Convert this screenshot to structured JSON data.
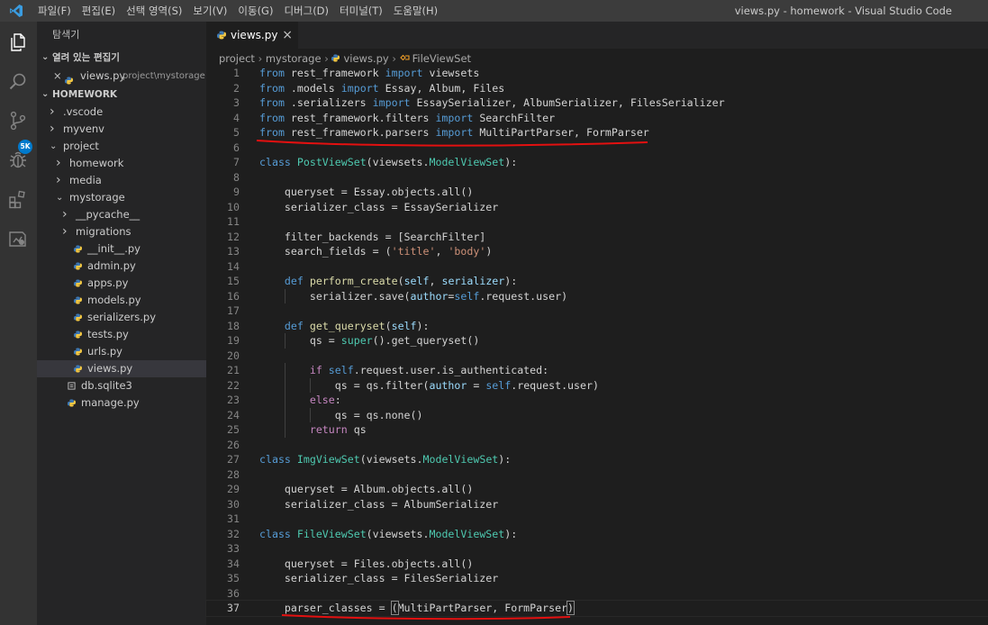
{
  "titlebar": {
    "menu": [
      "파일(F)",
      "편집(E)",
      "선택 영역(S)",
      "보기(V)",
      "이동(G)",
      "디버그(D)",
      "터미널(T)",
      "도움말(H)"
    ],
    "title": "views.py - homework - Visual Studio Code"
  },
  "activity_bar": {
    "icons": [
      "explorer-icon",
      "search-icon",
      "source-control-icon",
      "debug-icon",
      "extensions-icon",
      "remote-icon"
    ],
    "badge": "5K"
  },
  "sidebar": {
    "header": "탐색기",
    "open_editors_label": "열려 있는 편집기",
    "open_editor": {
      "close": "×",
      "name": "views.py",
      "path": "project\\mystorage"
    },
    "workspace_label": "HOMEWORK",
    "tree": [
      {
        "label": ".vscode",
        "type": "folder",
        "open": false,
        "depth": 1
      },
      {
        "label": "myvenv",
        "type": "folder",
        "open": false,
        "depth": 1
      },
      {
        "label": "project",
        "type": "folder",
        "open": true,
        "depth": 1
      },
      {
        "label": "homework",
        "type": "folder",
        "open": false,
        "depth": 2
      },
      {
        "label": "media",
        "type": "folder",
        "open": false,
        "depth": 2
      },
      {
        "label": "mystorage",
        "type": "folder",
        "open": true,
        "depth": 2
      },
      {
        "label": "__pycache__",
        "type": "folder",
        "open": false,
        "depth": 3
      },
      {
        "label": "migrations",
        "type": "folder",
        "open": false,
        "depth": 3
      },
      {
        "label": "__init__.py",
        "type": "py",
        "depth": 3
      },
      {
        "label": "admin.py",
        "type": "py",
        "depth": 3
      },
      {
        "label": "apps.py",
        "type": "py",
        "depth": 3
      },
      {
        "label": "models.py",
        "type": "py",
        "depth": 3
      },
      {
        "label": "serializers.py",
        "type": "py",
        "depth": 3
      },
      {
        "label": "tests.py",
        "type": "py",
        "depth": 3
      },
      {
        "label": "urls.py",
        "type": "py",
        "depth": 3
      },
      {
        "label": "views.py",
        "type": "py",
        "depth": 3,
        "selected": true
      },
      {
        "label": "db.sqlite3",
        "type": "db",
        "depth": 2
      },
      {
        "label": "manage.py",
        "type": "py",
        "depth": 2
      }
    ]
  },
  "editor": {
    "tab": {
      "label": "views.py",
      "close": "×"
    },
    "breadcrumb": [
      "project",
      "mystorage",
      "views.py",
      "FileViewSet"
    ],
    "lines": [
      [
        [
          "kw",
          "from"
        ],
        [
          "t",
          " rest_framework "
        ],
        [
          "kw",
          "import"
        ],
        [
          "t",
          " viewsets"
        ]
      ],
      [
        [
          "kw",
          "from"
        ],
        [
          "t",
          " .models "
        ],
        [
          "kw",
          "import"
        ],
        [
          "t",
          " Essay, Album, Files"
        ]
      ],
      [
        [
          "kw",
          "from"
        ],
        [
          "t",
          " .serializers "
        ],
        [
          "kw",
          "import"
        ],
        [
          "t",
          " EssaySerializer, AlbumSerializer, FilesSerializer"
        ]
      ],
      [
        [
          "kw",
          "from"
        ],
        [
          "t",
          " rest_framework.filters "
        ],
        [
          "kw",
          "import"
        ],
        [
          "t",
          " SearchFilter"
        ]
      ],
      [
        [
          "kw",
          "from"
        ],
        [
          "t",
          " rest_framework.parsers "
        ],
        [
          "kw",
          "import"
        ],
        [
          "t",
          " MultiPartParser, FormParser"
        ]
      ],
      [],
      [
        [
          "kw",
          "class"
        ],
        [
          "t",
          " "
        ],
        [
          "cls",
          "PostViewSet"
        ],
        [
          "t",
          "("
        ],
        [
          "t",
          "viewsets."
        ],
        [
          "cls",
          "ModelViewSet"
        ],
        [
          "t",
          "):"
        ]
      ],
      [],
      [
        [
          "t",
          "    queryset = Essay.objects.all()"
        ]
      ],
      [
        [
          "t",
          "    serializer_class = EssaySerializer"
        ]
      ],
      [],
      [
        [
          "t",
          "    filter_backends = [SearchFilter]"
        ]
      ],
      [
        [
          "t",
          "    search_fields = ("
        ],
        [
          "str",
          "'title'"
        ],
        [
          "t",
          ", "
        ],
        [
          "str",
          "'body'"
        ],
        [
          "t",
          ")"
        ]
      ],
      [],
      [
        [
          "t",
          "    "
        ],
        [
          "kw",
          "def"
        ],
        [
          "t",
          " "
        ],
        [
          "fn",
          "perform_create"
        ],
        [
          "t",
          "("
        ],
        [
          "var",
          "self"
        ],
        [
          "t",
          ", "
        ],
        [
          "var",
          "serializer"
        ],
        [
          "t",
          "):"
        ]
      ],
      [
        [
          "t",
          "        serializer.save("
        ],
        [
          "var",
          "author"
        ],
        [
          "t",
          "="
        ],
        [
          "kw",
          "self"
        ],
        [
          "t",
          ".request.user)"
        ]
      ],
      [],
      [
        [
          "t",
          "    "
        ],
        [
          "kw",
          "def"
        ],
        [
          "t",
          " "
        ],
        [
          "fn",
          "get_queryset"
        ],
        [
          "t",
          "("
        ],
        [
          "var",
          "self"
        ],
        [
          "t",
          "):"
        ]
      ],
      [
        [
          "t",
          "        qs = "
        ],
        [
          "cls",
          "super"
        ],
        [
          "t",
          "().get_queryset()"
        ]
      ],
      [],
      [
        [
          "t",
          "        "
        ],
        [
          "ctl",
          "if"
        ],
        [
          "t",
          " "
        ],
        [
          "kw",
          "self"
        ],
        [
          "t",
          ".request.user.is_authenticated:"
        ]
      ],
      [
        [
          "t",
          "            qs = qs.filter("
        ],
        [
          "var",
          "author"
        ],
        [
          "t",
          " = "
        ],
        [
          "kw",
          "self"
        ],
        [
          "t",
          ".request.user)"
        ]
      ],
      [
        [
          "t",
          "        "
        ],
        [
          "ctl",
          "else"
        ],
        [
          "t",
          ":"
        ]
      ],
      [
        [
          "t",
          "            qs = qs.none()"
        ]
      ],
      [
        [
          "t",
          "        "
        ],
        [
          "ctl",
          "return"
        ],
        [
          "t",
          " qs"
        ]
      ],
      [],
      [
        [
          "kw",
          "class"
        ],
        [
          "t",
          " "
        ],
        [
          "cls",
          "ImgViewSet"
        ],
        [
          "t",
          "("
        ],
        [
          "t",
          "viewsets."
        ],
        [
          "cls",
          "ModelViewSet"
        ],
        [
          "t",
          "):"
        ]
      ],
      [],
      [
        [
          "t",
          "    queryset = Album.objects.all()"
        ]
      ],
      [
        [
          "t",
          "    serializer_class = AlbumSerializer"
        ]
      ],
      [],
      [
        [
          "kw",
          "class"
        ],
        [
          "t",
          " "
        ],
        [
          "cls",
          "FileViewSet"
        ],
        [
          "t",
          "("
        ],
        [
          "t",
          "viewsets."
        ],
        [
          "cls",
          "ModelViewSet"
        ],
        [
          "t",
          "):"
        ]
      ],
      [],
      [
        [
          "t",
          "    queryset = Files.objects.all()"
        ]
      ],
      [
        [
          "t",
          "    serializer_class = FilesSerializer"
        ]
      ],
      [],
      [
        [
          "t",
          "    parser_classes = "
        ],
        [
          "br",
          "("
        ],
        [
          "t",
          "MultiPartParser, FormParser"
        ],
        [
          "br",
          ")"
        ]
      ]
    ],
    "active_line": 37
  }
}
